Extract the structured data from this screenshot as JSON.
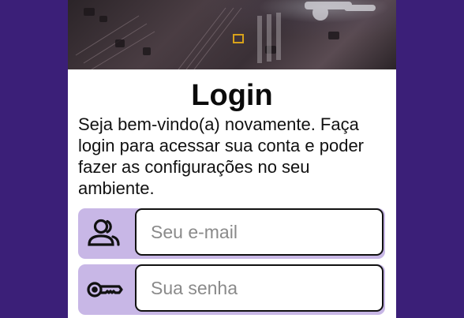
{
  "login": {
    "title": "Login",
    "subtitle": "Seja bem-vindo(a) novamente. Faça login para acessar sua conta e poder fazer as configurações no seu ambiente.",
    "email": {
      "placeholder": "Seu e-mail",
      "icon": "users-icon"
    },
    "password": {
      "placeholder": "Sua senha",
      "icon": "key-icon"
    }
  },
  "colors": {
    "page_background": "#3b1f78",
    "card_background": "#ffffff",
    "field_accent": "#c8b7e6",
    "text": "#111111"
  }
}
